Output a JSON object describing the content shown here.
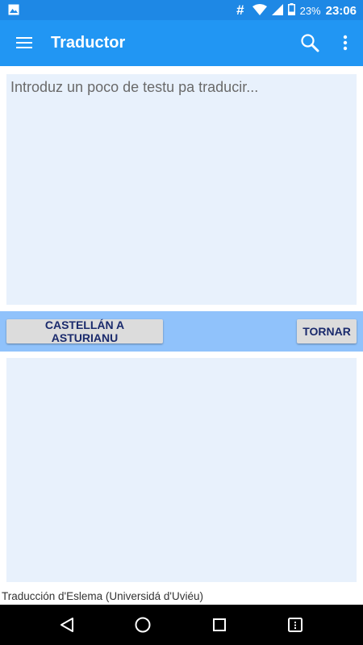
{
  "status_bar": {
    "notification_icon": "image-icon",
    "hash_symbol": "#",
    "battery_percent": "23%",
    "time": "23:06"
  },
  "app_bar": {
    "title": "Traductor",
    "menu_icon": "hamburger-menu-icon",
    "search_icon": "search-icon",
    "more_icon": "more-vert-icon"
  },
  "input": {
    "placeholder": "Introduz un poco de testu pa traducir...",
    "value": ""
  },
  "controls": {
    "direction_label": "CASTELLÁN A ASTURIANU",
    "swap_label": "TORNAR"
  },
  "output": {
    "value": ""
  },
  "footer": {
    "credit": "Traducción d'Eslema (Universidá d'Uviéu)"
  },
  "colors": {
    "status_bar": "#1e88e5",
    "app_bar": "#2196f3",
    "controls_strip": "#90c2fb",
    "text_area_bg": "#e8f1fc",
    "button_text": "#1a2a6c"
  }
}
